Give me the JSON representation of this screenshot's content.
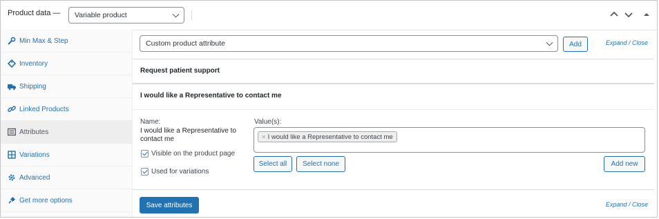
{
  "header": {
    "label": "Product data —",
    "product_type": "Variable product"
  },
  "sidebar": {
    "items": [
      {
        "label": "Min Max & Step",
        "icon": "wrench-icon"
      },
      {
        "label": "Inventory",
        "icon": "tag-icon"
      },
      {
        "label": "Shipping",
        "icon": "truck-icon"
      },
      {
        "label": "Linked Products",
        "icon": "link-icon"
      },
      {
        "label": "Attributes",
        "icon": "list-icon",
        "active": true
      },
      {
        "label": "Variations",
        "icon": "grid-icon"
      },
      {
        "label": "Advanced",
        "icon": "gear-icon"
      },
      {
        "label": "Get more options",
        "icon": "plugin-icon"
      }
    ]
  },
  "toolbar": {
    "attribute_select": "Custom product attribute",
    "add_label": "Add",
    "expand_close": "Expand / Close"
  },
  "attributes": {
    "row1_title": "Request patient support",
    "row2_title": "I would like a Representative to contact me",
    "name_label": "Name:",
    "name_value_line1": "I would like a Representative to",
    "name_value_line2": "contact me",
    "visible_label": "Visible on the product page",
    "variations_label": "Used for variations",
    "values_label": "Value(s):",
    "token_x": "×",
    "token_text": "I would like a Representative to contact me",
    "select_all": "Select all",
    "select_none": "Select none",
    "add_new": "Add new"
  },
  "footer": {
    "save_label": "Save attributes",
    "expand_close": "Expand / Close"
  },
  "colors": {
    "accent": "#2271b1",
    "sidebar_bg": "#fafafa",
    "active_bg": "#eeeeee"
  }
}
